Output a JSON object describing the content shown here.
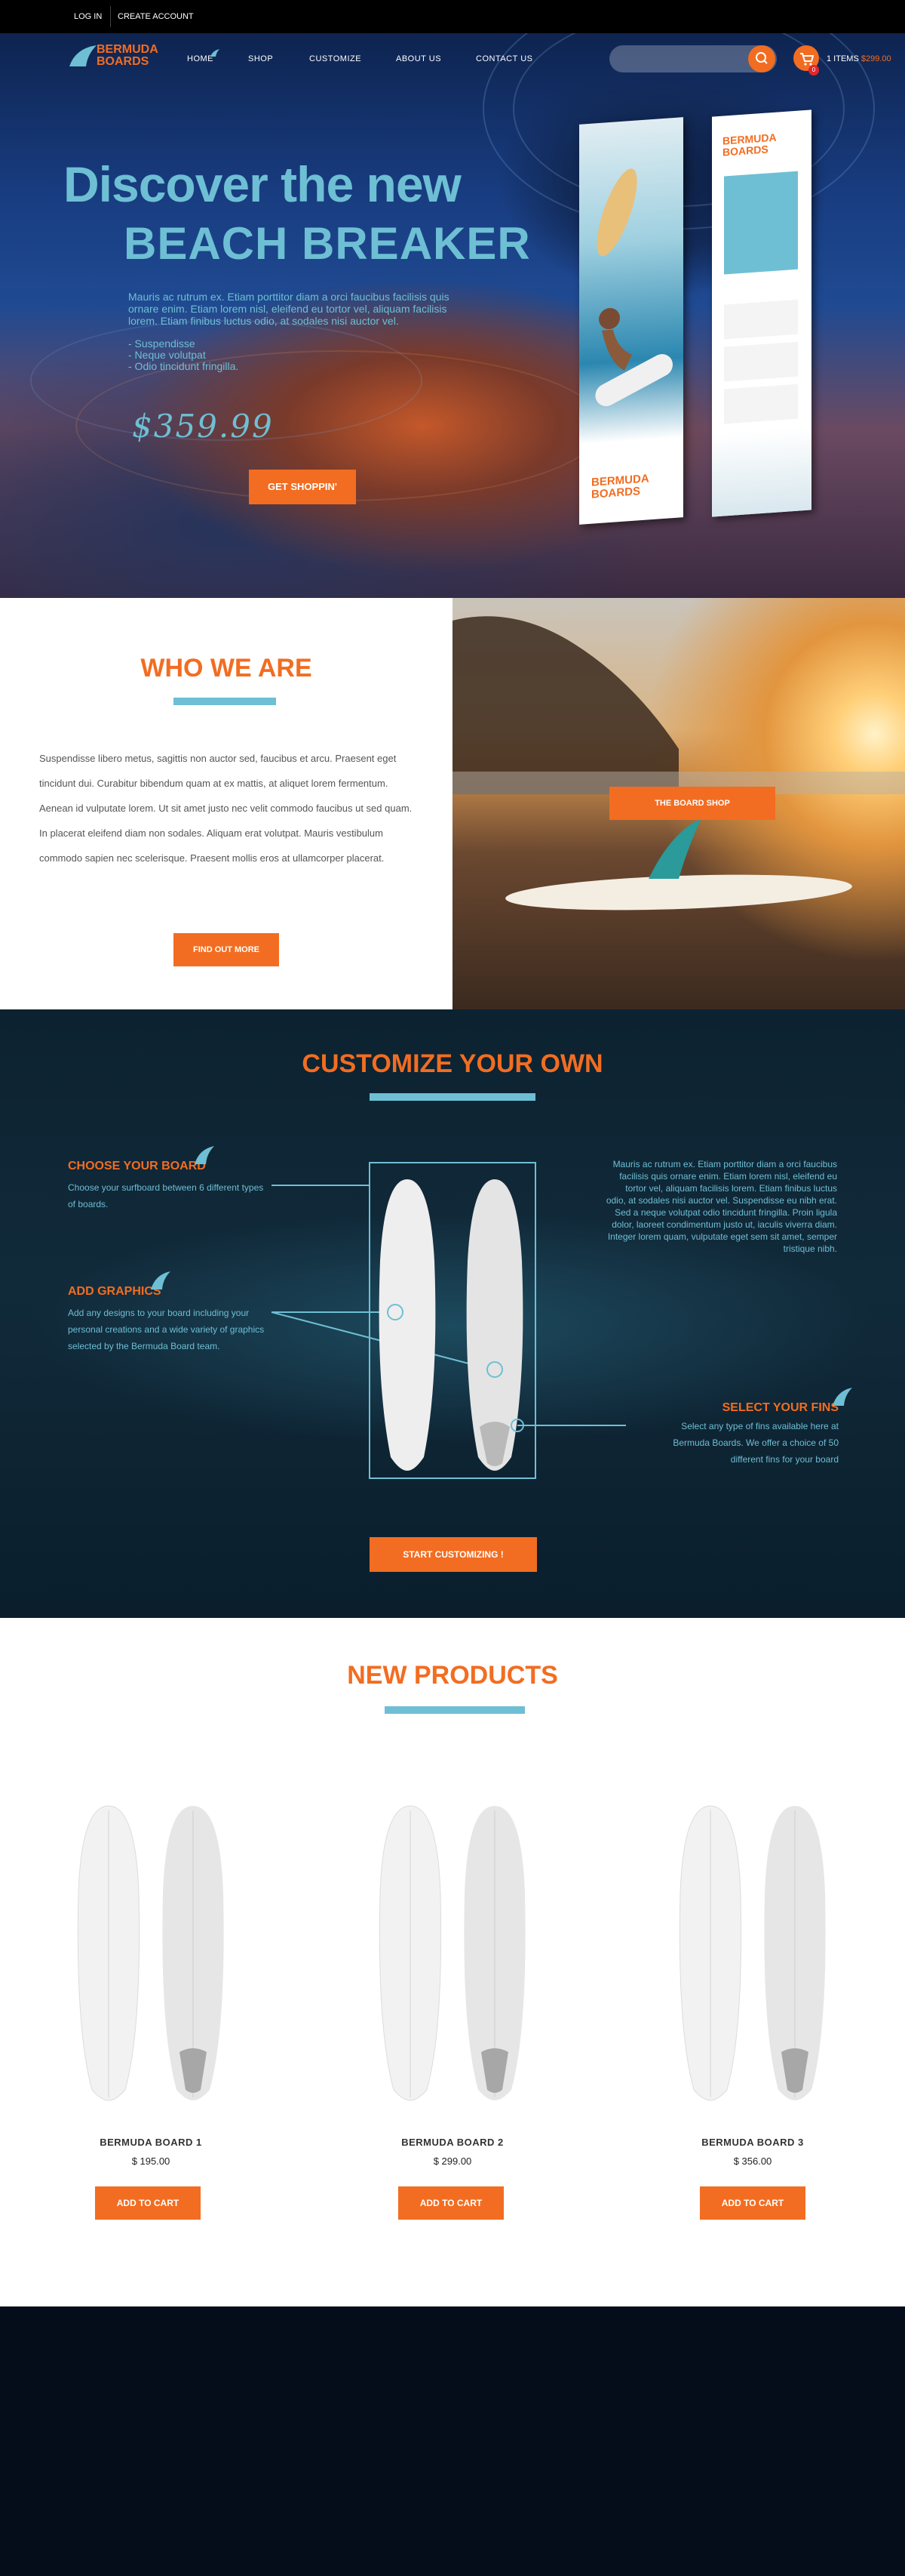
{
  "topbar": {
    "login": "LOG IN",
    "create_account": "CREATE ACCOUNT"
  },
  "logo": {
    "line1": "BERMUDA",
    "line2": "BOARDS"
  },
  "nav": {
    "home": "HOME",
    "shop": "SHOP",
    "customize": "CUSTOMIZE",
    "about": "ABOUT US",
    "contact": "CONTACT US"
  },
  "search": {
    "placeholder": ""
  },
  "cart": {
    "count": "0",
    "items_label": "1 ITEMS",
    "total": "$299.00"
  },
  "hero": {
    "line1": "Discover the new",
    "line2": "BEACH BREAKER",
    "description": "Mauris ac rutrum ex. Etiam porttitor diam a orci faucibus facilisis quis ornare enim. Etiam lorem nisl, eleifend eu tortor vel, aliquam facilisis lorem. Etiam finibus luctus odio, at sodales nisi auctor vel.",
    "list": [
      "- Suspendisse",
      "- Neque volutpat",
      "- Odio tincidunt fringilla."
    ],
    "price": "$359.99",
    "button": "GET SHOPPIN'"
  },
  "product_box": {
    "brand_line1": "BERMUDA",
    "brand_line2": "BOARDS"
  },
  "who": {
    "title": "WHO WE ARE",
    "text": "Suspendisse libero metus, sagittis non auctor sed, faucibus et arcu. Praesent eget tincidunt dui. Curabitur bibendum quam at ex mattis, at aliquet lorem fermentum. Aenean id vulputate lorem. Ut sit amet justo nec velit commodo faucibus ut sed quam. In placerat eleifend diam non sodales. Aliquam erat volutpat. Mauris vestibulum commodo sapien nec scelerisque. Praesent mollis eros at ullamcorper placerat.",
    "button": "FIND OUT MORE",
    "photo_button": "THE BOARD SHOP"
  },
  "customize": {
    "title": "CUSTOMIZE YOUR OWN",
    "choose_title": "CHOOSE YOUR BOARD",
    "choose_text": "Choose your surfboard between 6 different types of boards.",
    "graphics_title": "ADD GRAPHICS",
    "graphics_text": "Add any designs to your board including your personal creations and a wide variety of graphics selected by the Bermuda Board team.",
    "fins_title": "SELECT YOUR FINS",
    "fins_text": "Select any type of fins available here at Bermuda Boards. We offer a choice of 50 different fins for your board",
    "right_text": "Mauris ac rutrum ex. Etiam porttitor diam a orci faucibus facilisis quis ornare enim. Etiam lorem nisl, eleifend eu tortor vel, aliquam facilisis lorem. Etiam finibus luctus odio, at sodales nisi auctor vel. Suspendisse eu nibh erat. Sed a neque volutpat odio tincidunt fringilla. Proin ligula dolor, laoreet condimentum justo ut, iaculis viverra diam. Integer lorem quam, vulputate eget sem sit amet, semper tristique nibh.",
    "button": "START CUSTOMIZING !"
  },
  "new_products": {
    "title": "NEW PRODUCTS",
    "items": [
      {
        "name": "BERMUDA BOARD 1",
        "price": "$ 195.00",
        "button": "ADD TO CART"
      },
      {
        "name": "BERMUDA BOARD 2",
        "price": "$ 299.00",
        "button": "ADD TO CART"
      },
      {
        "name": "BERMUDA BOARD 3",
        "price": "$ 356.00",
        "button": "ADD TO CART"
      }
    ]
  },
  "colors": {
    "accent": "#f26d21",
    "teal": "#6ebfd4",
    "dark_section": "#0f2534",
    "footer": "#050d1a"
  }
}
